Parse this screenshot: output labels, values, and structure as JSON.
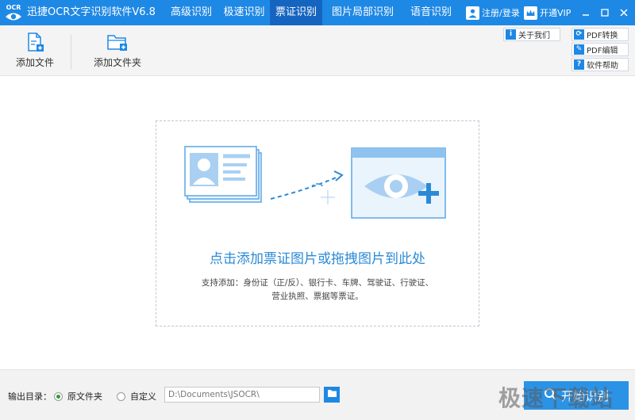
{
  "app": {
    "logo_text": "OCR",
    "title": "迅捷OCR文字识别软件V6.8",
    "nav_tabs": [
      {
        "label": "高级识别"
      },
      {
        "label": "极速识别"
      },
      {
        "label": "票证识别",
        "active": true
      },
      {
        "label": "图片局部识别"
      },
      {
        "label": "语音识别"
      }
    ],
    "login_label": "注册/登录",
    "vip_label": "开通VIP",
    "accent_color": "#1e88e5"
  },
  "toolbar": {
    "add_file_label": "添加文件",
    "add_folder_label": "添加文件夹",
    "about_label": "关于我们",
    "pdf_convert_label": "PDF转换",
    "pdf_edit_label": "PDF编辑",
    "help_label": "软件帮助"
  },
  "dropzone": {
    "title": "点击添加票证图片或拖拽图片到此处",
    "desc_line1": "支持添加：身份证（正/反）、银行卡、车牌、驾驶证、行驶证、",
    "desc_line2": "营业执照、票据等票证。"
  },
  "footer": {
    "output_label": "输出目录：",
    "option_original": "原文件夹",
    "option_custom": "自定义",
    "selected_option": "原文件夹",
    "path_value": "D:\\Documents\\JSOCR\\",
    "start_label": "开始识别",
    "watermark": "极速下载站"
  }
}
